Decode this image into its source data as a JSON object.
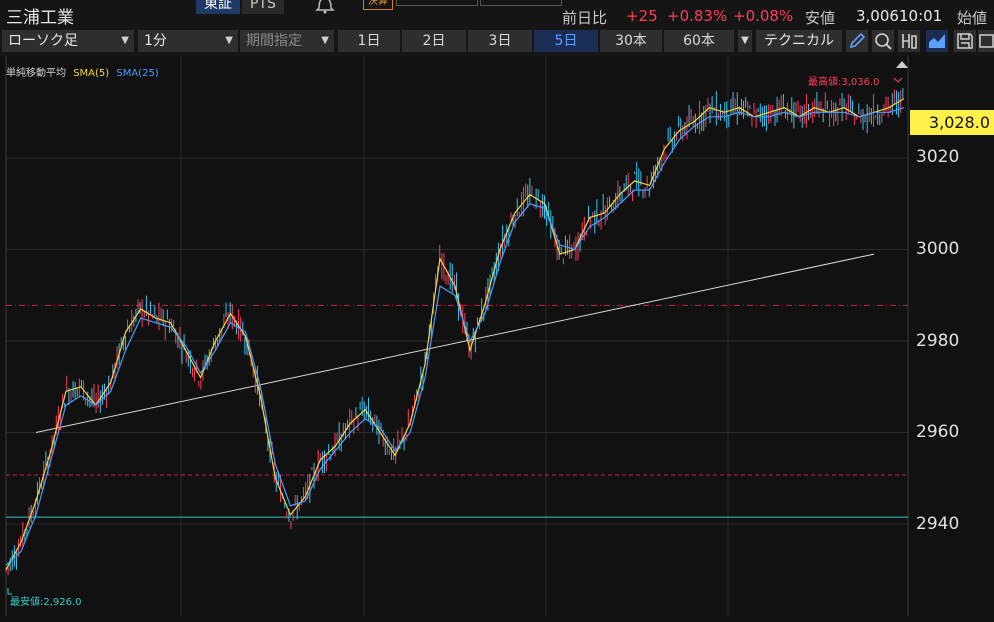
{
  "header": {
    "stock_name": "三浦工業",
    "market_tabs": [
      "東証",
      "PTS"
    ],
    "earnings_badge": "決算",
    "change_label": "前日比",
    "change_value": "+25",
    "change_pct": "+0.83%",
    "change_pct2": "+0.08%",
    "low_label": "安値",
    "low_value": "3,006",
    "time": "10:01",
    "open_label": "始値"
  },
  "toolbar": {
    "chart_type": "ローソク足",
    "interval": "1分",
    "period": "期間指定",
    "ranges": [
      "1日",
      "2日",
      "3日",
      "5日",
      "30本",
      "60本"
    ],
    "active_range": "5日",
    "technical": "テクニカル"
  },
  "legend": {
    "title": "単純移動平均",
    "sma5": "SMA(5)",
    "sma25": "SMA(25)"
  },
  "annotations": {
    "high": "最高値:3,036.0",
    "low": "最安値:2,926.0"
  },
  "current_price": "3,028.0",
  "colors": {
    "up": "#ff3d5a",
    "down": "#35c6f0",
    "sma5": "#f5d542",
    "sma25": "#4a9eff",
    "price_tag": "#fff04a",
    "accent": "#5aa0ff"
  },
  "chart_data": {
    "type": "line",
    "y_ticks": [
      "3020",
      "3000",
      "2980",
      "2960",
      "2940"
    ],
    "ylim": [
      2924,
      3043
    ],
    "x": [
      0,
      5,
      10,
      15,
      20,
      25,
      30,
      35,
      40,
      45,
      50,
      55,
      60,
      65,
      70,
      75,
      80,
      85,
      90,
      95,
      100,
      105,
      110,
      115,
      120,
      125,
      130,
      135,
      140,
      145,
      150,
      155,
      160,
      165,
      170,
      175,
      180,
      185,
      190,
      195,
      200,
      205,
      210,
      215,
      220,
      225,
      230,
      235,
      240,
      245,
      250,
      255,
      260,
      265,
      270,
      275,
      280,
      285,
      290,
      295,
      300
    ],
    "series": [
      {
        "name": "SMA(5)",
        "values": [
          2930,
          2936,
          2945,
          2956,
          2969,
          2970,
          2966,
          2971,
          2982,
          2987,
          2985,
          2984,
          2978,
          2972,
          2980,
          2986,
          2981,
          2968,
          2950,
          2942,
          2946,
          2954,
          2957,
          2962,
          2965,
          2960,
          2955,
          2962,
          2975,
          2998,
          2992,
          2978,
          2988,
          3000,
          3008,
          3012,
          3010,
          2999,
          3000,
          3007,
          3008,
          3012,
          3015,
          3014,
          3022,
          3026,
          3028,
          3031,
          3030,
          3031,
          3029,
          3030,
          3031,
          3029,
          3031,
          3030,
          3031,
          3029,
          3030,
          3031,
          3033
        ]
      },
      {
        "name": "SMA(25)",
        "values": [
          2931,
          2934,
          2942,
          2954,
          2966,
          2968,
          2966,
          2969,
          2978,
          2985,
          2984,
          2983,
          2979,
          2973,
          2978,
          2984,
          2982,
          2970,
          2953,
          2944,
          2945,
          2952,
          2956,
          2960,
          2963,
          2961,
          2956,
          2960,
          2972,
          2992,
          2990,
          2980,
          2986,
          2997,
          3006,
          3010,
          3009,
          3001,
          3000,
          3005,
          3007,
          3010,
          3013,
          3013,
          3019,
          3024,
          3027,
          3029,
          3029,
          3030,
          3029,
          3029,
          3030,
          3029,
          3030,
          3030,
          3030,
          3029,
          3030,
          3030,
          3031
        ]
      }
    ],
    "horizontal_lines": [
      2987.8,
      2950.7,
      2941.5
    ],
    "trendline": [
      [
        10,
        2960
      ],
      [
        290,
        2999
      ]
    ],
    "high": 3036.0,
    "low": 2926.0
  }
}
